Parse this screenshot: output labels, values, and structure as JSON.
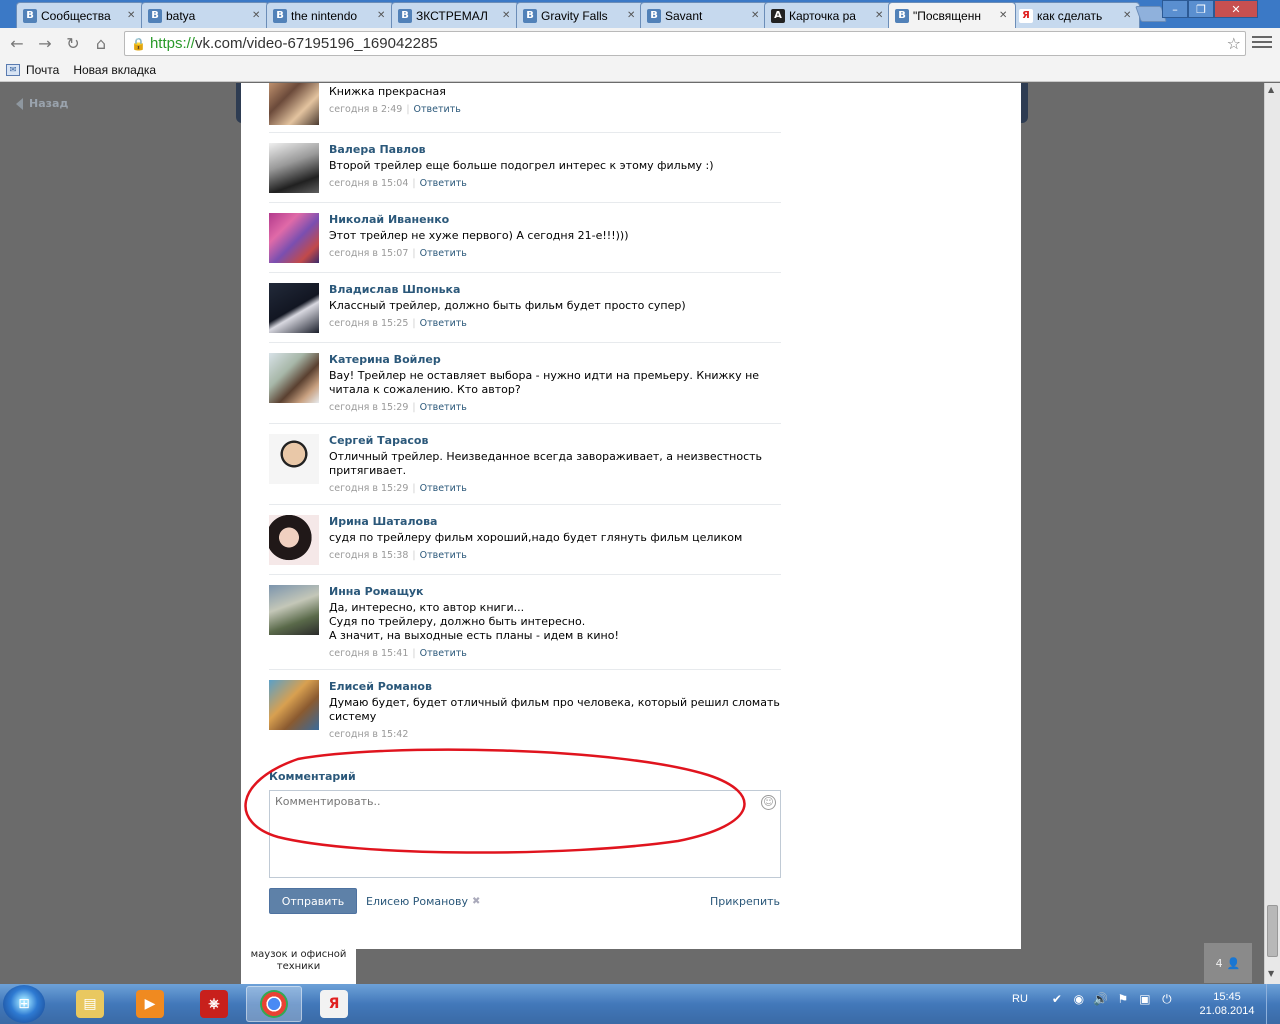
{
  "browser": {
    "tabs": [
      {
        "label": "Сообщества",
        "icon": "vk-icon",
        "fav": "B",
        "color": "#5181b8"
      },
      {
        "label": "batya",
        "icon": "vk-icon",
        "fav": "B",
        "color": "#5181b8"
      },
      {
        "label": "the nintendo",
        "icon": "vk-icon",
        "fav": "B",
        "color": "#5181b8"
      },
      {
        "label": "ЗКСТРЕМАЛ",
        "icon": "vk-icon",
        "fav": "B",
        "color": "#5181b8"
      },
      {
        "label": "Gravity Falls",
        "icon": "vk-icon",
        "fav": "B",
        "color": "#5181b8"
      },
      {
        "label": "Savant",
        "icon": "vk-icon",
        "fav": "B",
        "color": "#5181b8"
      },
      {
        "label": "Карточка ра",
        "icon": "a-logo-icon",
        "fav": "A",
        "color": "#222222"
      },
      {
        "label": "\"Посвященн",
        "icon": "vk-icon",
        "fav": "B",
        "color": "#5181b8",
        "active": true
      },
      {
        "label": "как сделать",
        "icon": "yandex-icon",
        "fav": "Я",
        "color": "#e02020"
      }
    ],
    "url_scheme": "https://",
    "url_rest": "vk.com/video-67195196_169042285",
    "bookmarks": [
      {
        "label": "Почта",
        "icon": "mail-icon"
      },
      {
        "label": "Новая вкладка",
        "icon": "page-icon"
      }
    ]
  },
  "page": {
    "back_label": "Назад",
    "bg_under_text": "маузок и офисной техники"
  },
  "comments": [
    {
      "name": "",
      "text": "Книжка прекрасная",
      "time": "сегодня в 2:49",
      "reply": "Ответить",
      "avatar": "av1"
    },
    {
      "name": "Валера Павлов",
      "text": "Второй трейлер еще больше подогрел интерес к этому фильму :)",
      "time": "сегодня в 15:04",
      "reply": "Ответить",
      "avatar": "av2"
    },
    {
      "name": "Николай Иваненко",
      "text": "Этот трейлер не хуже первого) А сегодня 21-е!!!)))",
      "time": "сегодня в 15:07",
      "reply": "Ответить",
      "avatar": "av3"
    },
    {
      "name": "Владислав Шпонька",
      "text": "Классный трейлер, должно быть фильм будет просто супер)",
      "time": "сегодня в 15:25",
      "reply": "Ответить",
      "avatar": "av4"
    },
    {
      "name": "Катерина Войлер",
      "text": "Вау! Трейлер не оставляет выбора - нужно идти на премьеру. Книжку не читала к сожалению. Кто автор?",
      "time": "сегодня в 15:29",
      "reply": "Ответить",
      "avatar": "av5"
    },
    {
      "name": "Сергей Тарасов",
      "text": "Отличный трейлер. Неизведанное всегда завораживает, а неизвестность притягивает.",
      "time": "сегодня в 15:29",
      "reply": "Ответить",
      "avatar": "av6"
    },
    {
      "name": "Ирина Шаталова",
      "text": "судя по трейлеру фильм хороший,надо будет глянуть фильм целиком",
      "time": "сегодня в 15:38",
      "reply": "Ответить",
      "avatar": "av7"
    },
    {
      "name": "Инна Ромащук",
      "text": "Да, интересно, кто автор книги...\nСудя по трейлеру, должно быть интересно.\nА значит, на выходные есть планы - идем в кино!",
      "time": "сегодня в 15:41",
      "reply": "Ответить",
      "avatar": "av8"
    },
    {
      "name": "Елисей Романов",
      "text": "Думаю будет, будет отличный фильм про человека, который решил сломать систему",
      "time": "сегодня в 15:42",
      "reply": "",
      "avatar": "av9"
    }
  ],
  "composer": {
    "label": "Комментарий",
    "placeholder": "Комментировать..",
    "send": "Отправить",
    "reply_to": "Елисею Романову",
    "attach": "Прикрепить"
  },
  "side_counter": "4",
  "taskbar": {
    "lang": "RU",
    "time": "15:45",
    "date": "21.08.2014"
  },
  "colors": {
    "link": "#2b587a",
    "button": "#5e81a8",
    "highlight_circle": "#e0141e"
  }
}
